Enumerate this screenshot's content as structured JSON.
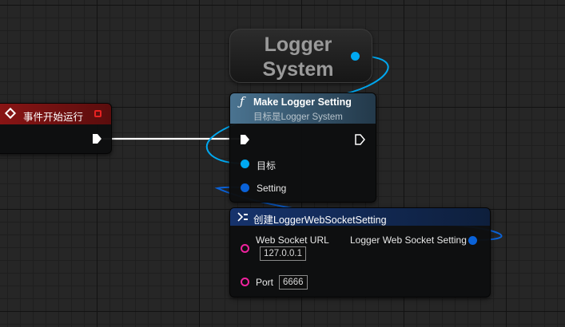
{
  "colors": {
    "exec": "#ffffff",
    "object_pin": "#00a8f0",
    "struct_pin": "#0a62d8",
    "string_pin": "#f0229e",
    "event_header": "#7a1212",
    "function_header": "#3a5f78",
    "make_struct_header": "#1a3a78"
  },
  "event_node": {
    "icon": "event-diamond-icon",
    "title": "事件开始运行"
  },
  "logger_system_node": {
    "title": "Logger System"
  },
  "make_setting_node": {
    "icon": "function-icon",
    "icon_glyph": "ƒ",
    "title": "Make Logger Setting",
    "subtitle": "目标是Logger System",
    "pins": {
      "target": "目标",
      "setting": "Setting"
    }
  },
  "create_ws_node": {
    "icon": "make-struct-icon",
    "title": "创建LoggerWebSocketSetting",
    "pins": {
      "url_label": "Web Socket URL",
      "url_value": "127.0.0.1",
      "port_label": "Port",
      "port_value": "6666",
      "output_label": "Logger Web Socket Setting"
    }
  }
}
